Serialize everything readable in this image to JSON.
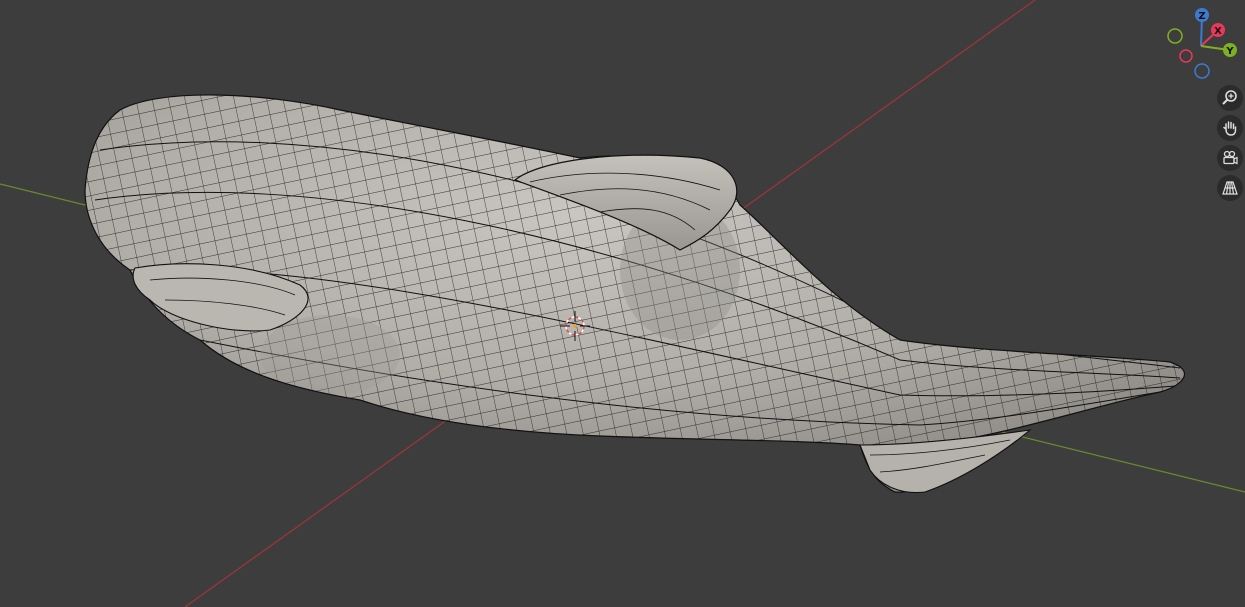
{
  "viewport": {
    "background": "#3d3d3d",
    "grid_axis_x_color": "#a0353a",
    "grid_axis_y_color": "#6b8a2e"
  },
  "gizmo": {
    "axes": [
      {
        "label": "Z",
        "color": "#3d7bd1"
      },
      {
        "label": "X",
        "color": "#e8385b"
      },
      {
        "label": "Y",
        "color": "#7fb021"
      }
    ]
  },
  "navigation": [
    {
      "name": "zoom-icon"
    },
    {
      "name": "pan-hand-icon"
    },
    {
      "name": "camera-view-icon"
    },
    {
      "name": "perspective-grid-icon"
    }
  ],
  "object": {
    "name": "whale-mesh",
    "shading": "solid-wireframe",
    "fill": "#b3b0ab",
    "edge_color": "#111111"
  }
}
